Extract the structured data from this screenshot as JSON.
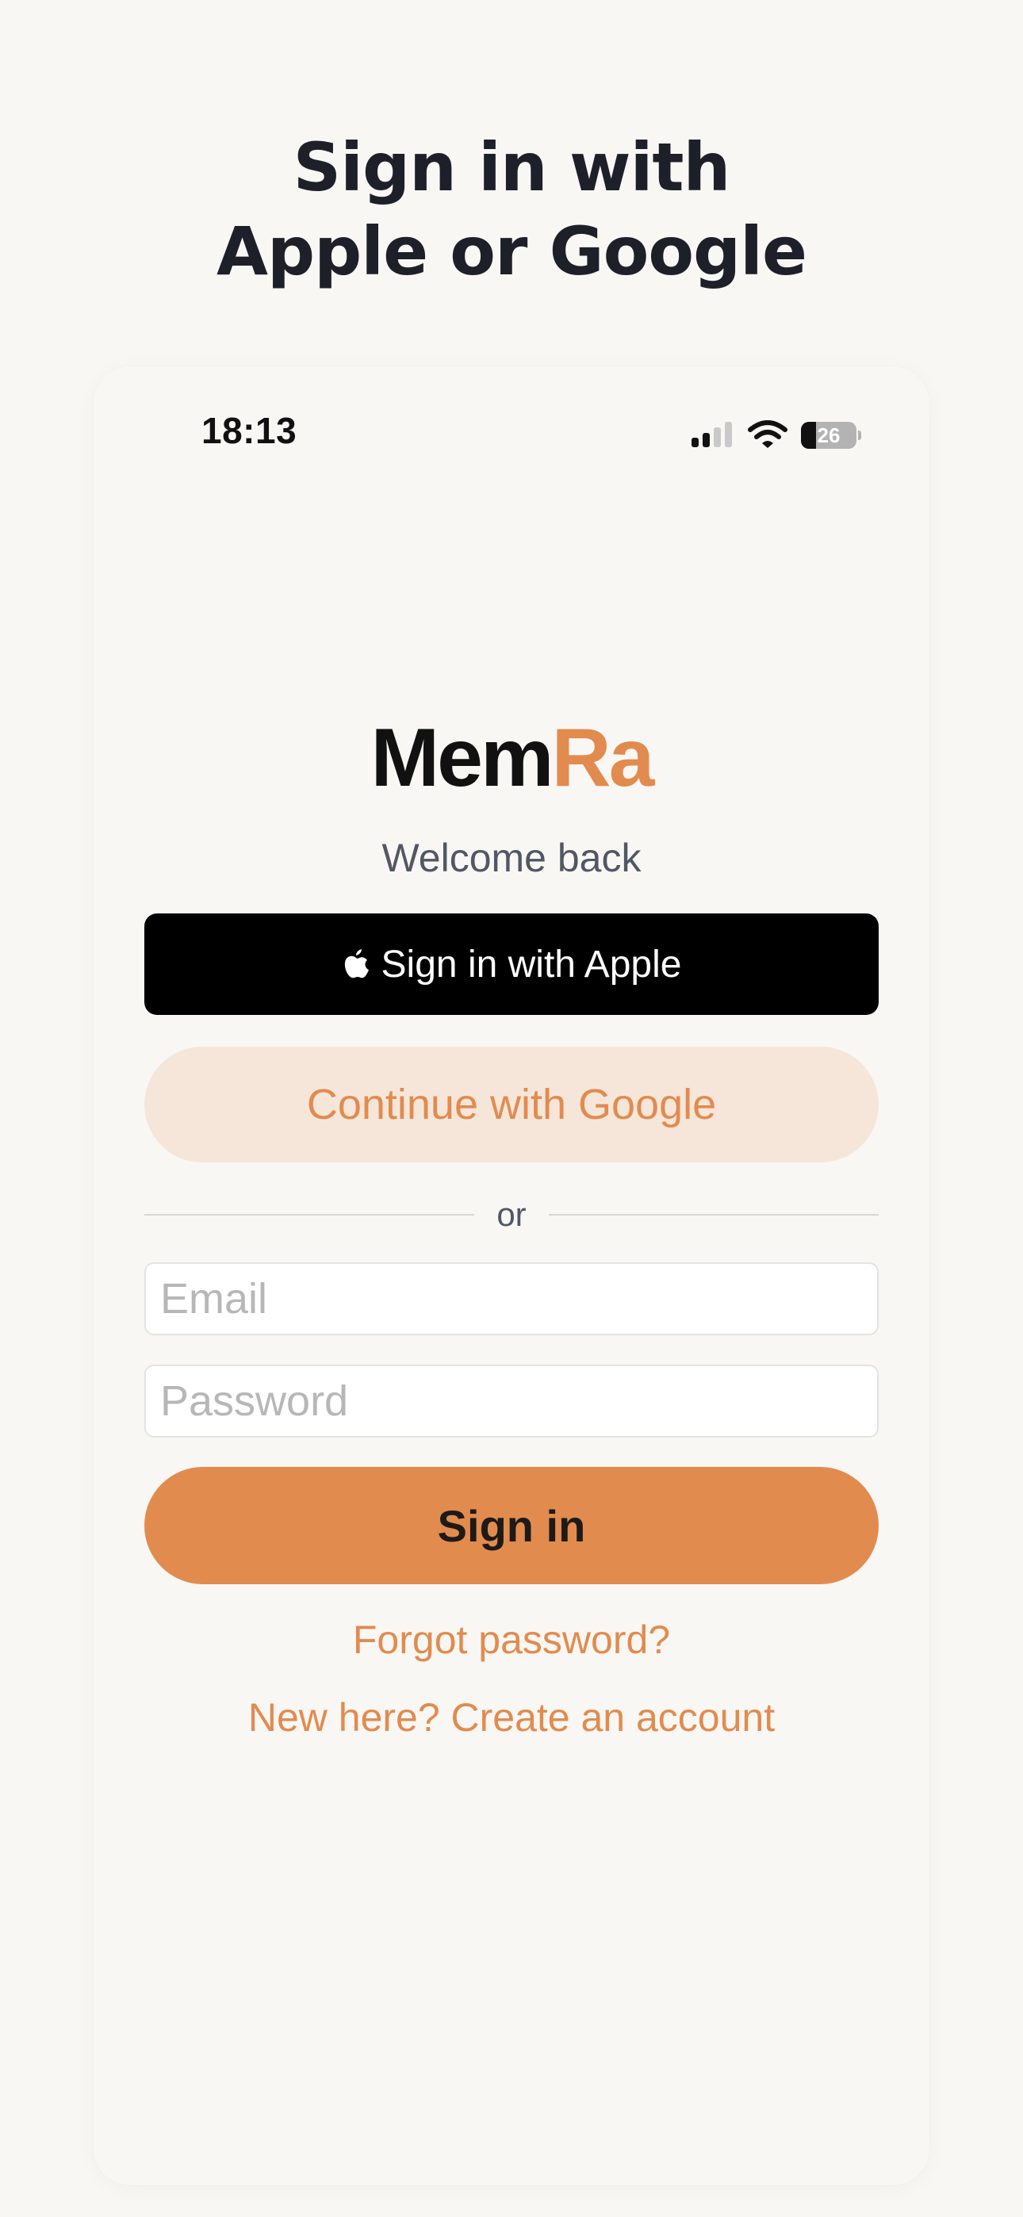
{
  "headline": {
    "line1": "Sign in with",
    "line2": "Apple or Google"
  },
  "status_bar": {
    "time": "18:13",
    "battery_percent": "26",
    "icons": [
      "cellular-signal-icon",
      "wifi-icon",
      "battery-icon"
    ]
  },
  "brand": {
    "logo_part1": "Mem",
    "logo_part2": "Ra",
    "accent_color": "#e28b4e"
  },
  "welcome_text": "Welcome back",
  "apple_button": {
    "label": "Sign in with Apple",
    "icon": "apple-logo-icon"
  },
  "google_button": {
    "label": "Continue with Google"
  },
  "divider_text": "or",
  "email_field": {
    "placeholder": "Email",
    "value": ""
  },
  "password_field": {
    "placeholder": "Password",
    "value": ""
  },
  "sign_in_button": {
    "label": "Sign in"
  },
  "forgot_password_link": "Forgot password?",
  "create_account_link": "New here? Create an account"
}
